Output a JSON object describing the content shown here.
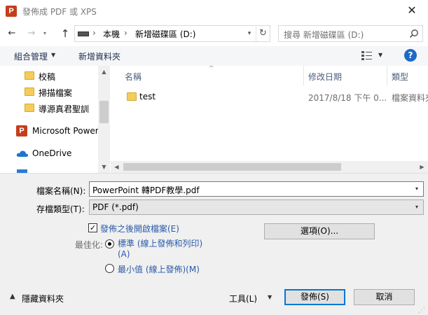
{
  "window": {
    "title": "發佈成 PDF 或 XPS",
    "app_icon_letter": "P",
    "close_glyph": "✕"
  },
  "nav": {
    "back_glyph": "←",
    "forward_glyph": "→",
    "history_glyph": "▾",
    "up_glyph": "↑",
    "breadcrumb": [
      "本機",
      "新增磁碟區 (D:)"
    ],
    "crumb_sep": "›",
    "addr_drop_glyph": "▾",
    "refresh_glyph": "↻",
    "search_placeholder": "搜尋 新增磁碟區 (D:)"
  },
  "toolbar": {
    "organize_label": "組合管理",
    "organize_arrow": "▼",
    "new_folder_label": "新增資料夾",
    "view_arrow": "▼",
    "help_label": "?"
  },
  "sidebar": {
    "items": [
      {
        "label": "校稿"
      },
      {
        "label": "掃描檔案"
      },
      {
        "label": "導源真君聖訓"
      },
      {
        "label": "Microsoft Powerl"
      },
      {
        "label": "OneDrive"
      }
    ],
    "scroll_up": "▲",
    "scroll_down": "▼"
  },
  "filelist": {
    "columns": [
      "名稱",
      "修改日期",
      "類型"
    ],
    "sort_glyph": "^",
    "rows": [
      {
        "name": "test",
        "date": "2017/8/18 下午 0...",
        "type": "檔案資料夾"
      }
    ],
    "scroll_left": "◀",
    "scroll_right": "▶"
  },
  "form": {
    "filename_label": "檔案名稱(N):",
    "filename_value": "PowerPoint 轉PDF教學.pdf",
    "filetype_label": "存檔類型(T):",
    "filetype_value": "PDF (*.pdf)",
    "drop_glyph": "▾",
    "open_after_publish_label": "發佈之後開啟檔案(E)",
    "open_after_publish_checked": true,
    "check_glyph": "✓",
    "optimize_label": "最佳化:",
    "radio_standard_label": "標準 (線上發佈和列印)",
    "radio_standard_accel": "(A)",
    "radio_min_label": "最小值 (線上發佈)(M)",
    "selected_option": "standard",
    "options_button": "選項(O)...",
    "tools_label": "工具(L)",
    "tools_arrow": "▼",
    "save_button": "發佈(S)",
    "cancel_button": "取消",
    "hide_folders_label": "隱藏資料夾",
    "hide_arrow": "▲",
    "grip_glyph": "⋰"
  }
}
